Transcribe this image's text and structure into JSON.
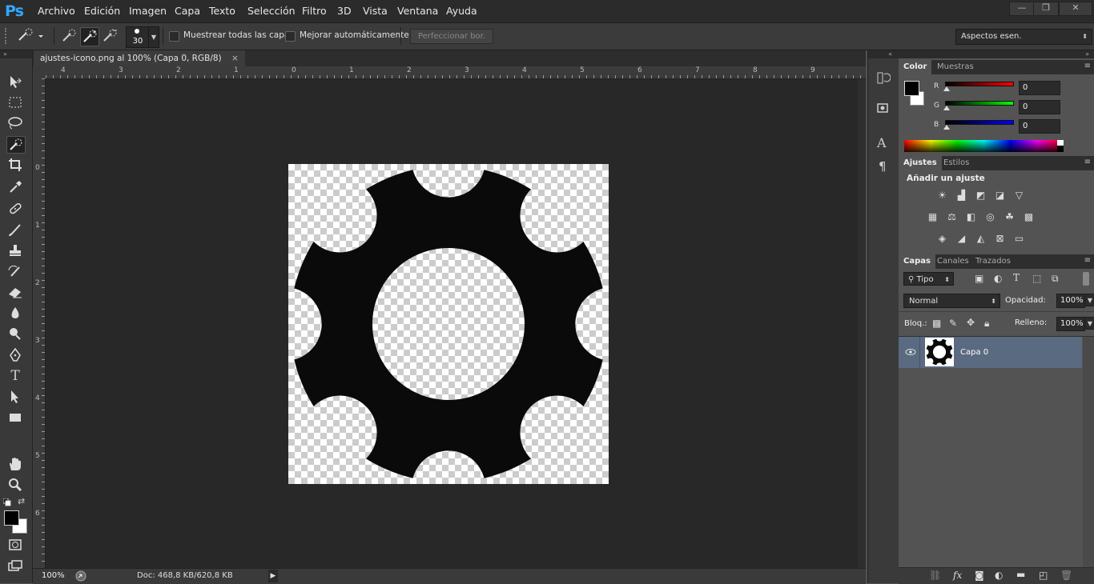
{
  "app": {
    "logo": "Ps"
  },
  "menu": [
    "Archivo",
    "Edición",
    "Imagen",
    "Capa",
    "Texto",
    "Selección",
    "Filtro",
    "3D",
    "Vista",
    "Ventana",
    "Ayuda"
  ],
  "window_controls": {
    "minimize": "—",
    "restore": "❐",
    "close": "✕"
  },
  "options": {
    "brush_size": "30",
    "sample_all_layers": "Muestrear todas las capas",
    "auto_enhance": "Mejorar automáticamente",
    "refine_edge": "Perfeccionar bor.",
    "workspace": "Aspectos esen."
  },
  "document": {
    "tab_title": "ajustes-icono.png al 100% (Capa 0, RGB/8)",
    "tab_close": "×",
    "ruler_top_labels": [
      "4",
      "3",
      "2",
      "1",
      "0",
      "1",
      "2",
      "3",
      "4",
      "5",
      "6",
      "7",
      "8",
      "9"
    ],
    "ruler_left_labels": [
      "0",
      "1",
      "2",
      "3",
      "4",
      "5",
      "6"
    ]
  },
  "status": {
    "zoom": "100%",
    "doc": "Doc: 468,8 KB/620,8 KB"
  },
  "color_panel": {
    "tabs": [
      "Color",
      "Muestras"
    ],
    "channels": [
      {
        "label": "R",
        "value": "0",
        "color": "#ff0000"
      },
      {
        "label": "G",
        "value": "0",
        "color": "#00ff00"
      },
      {
        "label": "B",
        "value": "0",
        "color": "#0000ff"
      }
    ]
  },
  "adjustments_panel": {
    "tabs": [
      "Ajustes",
      "Estilos"
    ],
    "heading": "Añadir un ajuste"
  },
  "layers_panel": {
    "tabs": [
      "Capas",
      "Canales",
      "Trazados"
    ],
    "filter_kind": "Tipo",
    "blend_mode": "Normal",
    "opacity_label": "Opacidad:",
    "opacity_value": "100%",
    "lock_label": "Bloq.:",
    "fill_label": "Relleno:",
    "fill_value": "100%",
    "layers": [
      {
        "name": "Capa 0",
        "visible": true
      }
    ]
  },
  "colors": {
    "accent": "#31a8ff",
    "layer_selected": "#5a6a80"
  }
}
